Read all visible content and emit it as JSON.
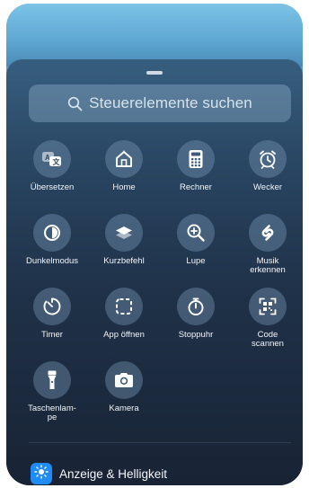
{
  "search": {
    "placeholder": "Steuerelemente suchen",
    "icon": "magnifier-icon"
  },
  "controls": [
    {
      "label": "Übersetzen",
      "icon": "translate-icon"
    },
    {
      "label": "Home",
      "icon": "home-icon"
    },
    {
      "label": "Rechner",
      "icon": "calculator-icon"
    },
    {
      "label": "Wecker",
      "icon": "alarm-clock-icon"
    },
    {
      "label": "Dunkelmodus",
      "icon": "dark-mode-icon"
    },
    {
      "label": "Kurzbefehl",
      "icon": "shortcuts-icon"
    },
    {
      "label": "Lupe",
      "icon": "magnifier-zoom-icon"
    },
    {
      "label": "Musik\nerkennen",
      "icon": "shazam-icon"
    },
    {
      "label": "Timer",
      "icon": "timer-icon"
    },
    {
      "label": "App öffnen",
      "icon": "open-app-icon"
    },
    {
      "label": "Stoppuhr",
      "icon": "stopwatch-icon"
    },
    {
      "label": "Code\nscannen",
      "icon": "qr-code-icon"
    },
    {
      "label": "Taschenlam-\npe",
      "icon": "flashlight-icon"
    },
    {
      "label": "Kamera",
      "icon": "camera-icon"
    }
  ],
  "section": {
    "label": "Anzeige & Helligkeit",
    "icon": "sun-icon",
    "icon_color": "#1f8cf5"
  }
}
